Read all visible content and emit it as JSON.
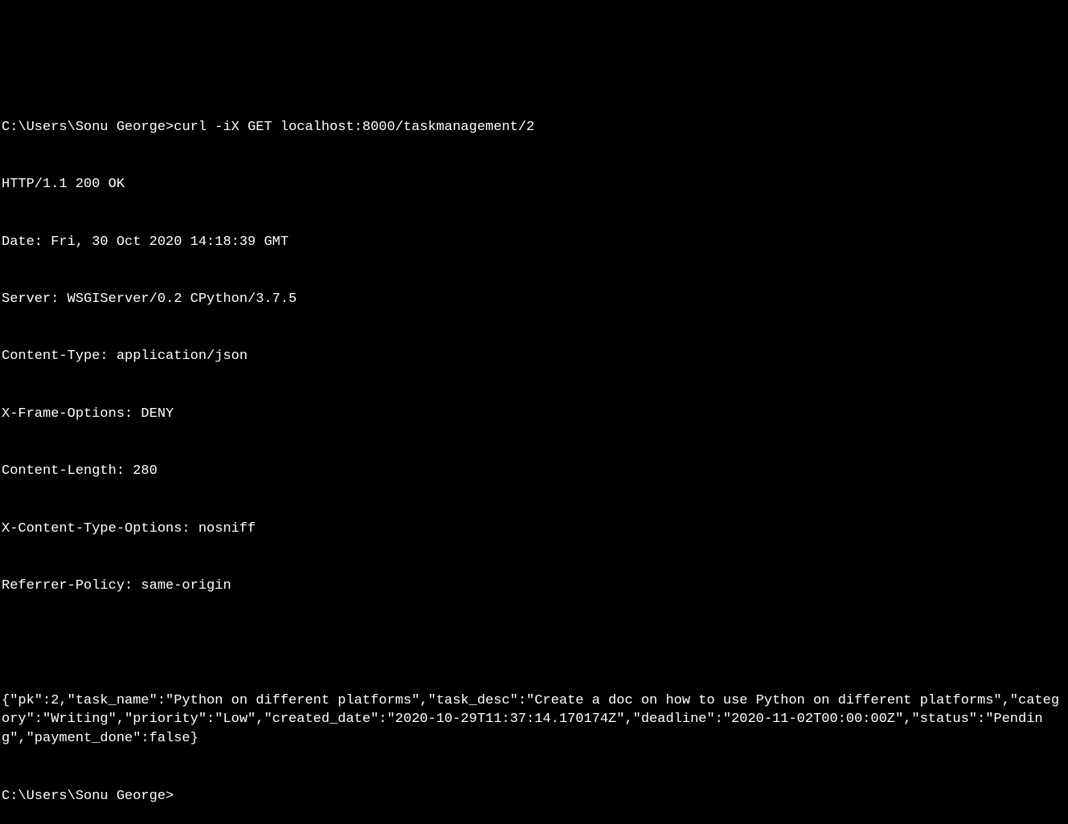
{
  "prompt1": "C:\\Users\\Sonu George>",
  "command1": "curl -iX GET localhost:8000/taskmanagement/2",
  "response_headers": [
    "HTTP/1.1 200 OK",
    "Date: Fri, 30 Oct 2020 14:18:39 GMT",
    "Server: WSGIServer/0.2 CPython/3.7.5",
    "Content-Type: application/json",
    "X-Frame-Options: DENY",
    "Content-Length: 280",
    "X-Content-Type-Options: nosniff",
    "Referrer-Policy: same-origin"
  ],
  "response_body": "{\"pk\":2,\"task_name\":\"Python on different platforms\",\"task_desc\":\"Create a doc on how to use Python on different platforms\",\"category\":\"Writing\",\"priority\":\"Low\",\"created_date\":\"2020-10-29T11:37:14.170174Z\",\"deadline\":\"2020-11-02T00:00:00Z\",\"status\":\"Pending\",\"payment_done\":false}",
  "prompt2": "C:\\Users\\Sonu George>"
}
